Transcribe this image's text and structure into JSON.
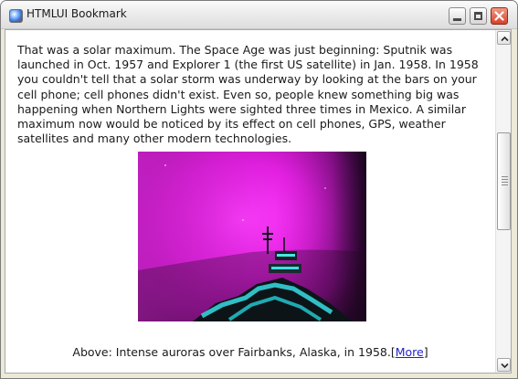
{
  "window": {
    "title": "HTMLUI Bookmark",
    "icon": "app-icon"
  },
  "controls": {
    "minimize_icon": "minimize-icon",
    "maximize_icon": "maximize-icon",
    "close_icon": "close-icon"
  },
  "article": {
    "text": "That was a solar maximum. The Space Age was just beginning: Sputnik was launched in Oct. 1957 and Explorer 1 (the first US satellite) in Jan. 1958. In 1958 you couldn't tell that a solar storm was underway by looking at the bars on your cell phone; cell phones didn't exist. Even so, people knew something big was happening when Northern Lights were sighted three times in Mexico. A similar maximum now would be noticed by its effect on cell phones, GPS, weather satellites and many other modern technologies."
  },
  "figure": {
    "image": "aurora-photo"
  },
  "caption": {
    "text": "Above: Intense auroras over Fairbanks, Alaska, in 1958.",
    "bracket_open": "[",
    "link_label": "More",
    "bracket_close": "]"
  },
  "scrollbar": {
    "up_icon": "scroll-up-arrow-icon",
    "down_icon": "scroll-down-arrow-icon"
  }
}
